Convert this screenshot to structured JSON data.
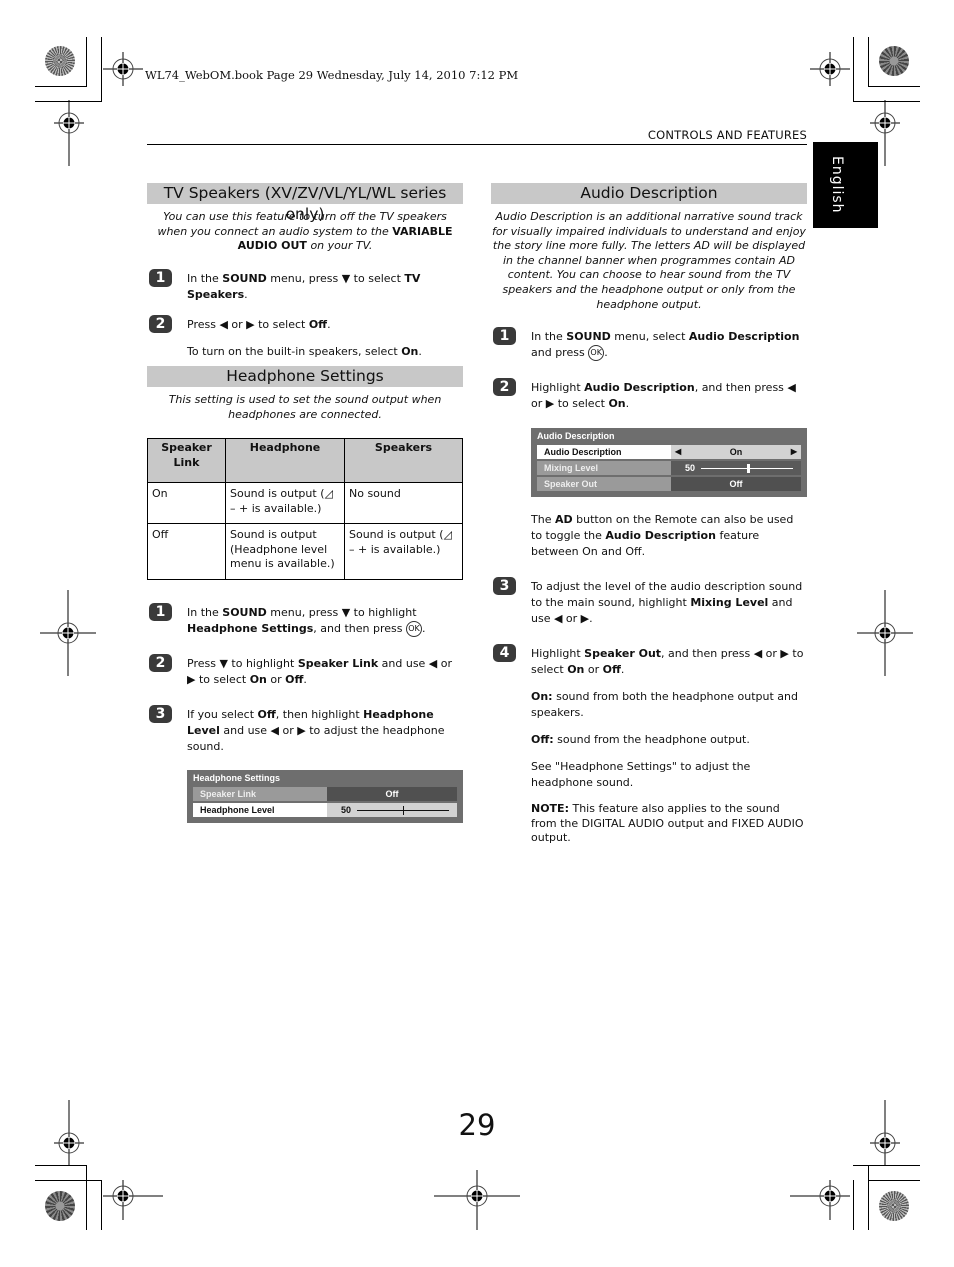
{
  "slug": "WL74_WebOM.book  Page 29  Wednesday, July 14, 2010  7:12 PM",
  "header": {
    "section": "CONTROLS AND FEATURES",
    "language_tab": "English"
  },
  "tv_speakers": {
    "title": "TV Speakers (XV/ZV/VL/YL/WL series only)",
    "intro_pre": "You can use this feature to turn off the TV speakers when you connect an audio system to the ",
    "intro_bold": "VARIABLE AUDIO OUT",
    "intro_post": " on your TV.",
    "steps": [
      {
        "num": "1",
        "t1": "In the ",
        "b1": "SOUND",
        "t2": " menu, press ▼ to select ",
        "b2": "TV Speakers",
        "t3": "."
      },
      {
        "num": "2",
        "t1": "Press ◀ or ▶ to select ",
        "b1": "Off",
        "t2": "."
      }
    ],
    "note_pre": "To turn on the built-in speakers, select ",
    "note_bold": "On",
    "note_post": "."
  },
  "headphone": {
    "title": "Headphone Settings",
    "intro": "This setting is used to set the sound output when headphones are connected.",
    "table": {
      "headers": [
        "Speaker Link",
        "Headphone",
        "Speakers"
      ],
      "rows": [
        [
          "On",
          " Sound is output (◿ – + is available.)",
          "No sound"
        ],
        [
          "Off",
          "Sound is output (Headphone level menu is available.)",
          "Sound is output (◿ – + is available.)"
        ]
      ]
    },
    "steps": [
      {
        "num": "1",
        "t1": "In the ",
        "b1": "SOUND",
        "t2": " menu, press ▼ to highlight ",
        "b2": "Headphone Settings",
        "t3": ", and then press ",
        "ok": "OK",
        "t4": "."
      },
      {
        "num": "2",
        "t1": "Press ▼ to highlight ",
        "b1": "Speaker Link",
        "t2": " and use ◀ or ▶ to select ",
        "b2": "On",
        "t3": " or ",
        "b3": "Off",
        "t4": "."
      },
      {
        "num": "3",
        "t1": "If you select ",
        "b1": "Off",
        "t2": ", then highlight ",
        "b2": "Headphone Level",
        "t3": " and use ◀ or ▶ to adjust the headphone sound."
      }
    ],
    "osd": {
      "title": "Headphone Settings",
      "rows": [
        {
          "label": "Speaker Link",
          "value": "Off"
        },
        {
          "label": "Headphone Level",
          "value": "50",
          "level_fraction": 0.5
        }
      ]
    }
  },
  "audio_description": {
    "title": "Audio Description",
    "intro": "Audio Description is an additional narrative sound track for visually impaired individuals to understand and enjoy the story line more fully. The letters AD will be displayed in the channel banner when programmes contain AD content.  You can choose to hear sound from the TV speakers and the headphone output or only from the headphone output.",
    "steps": [
      {
        "num": "1",
        "t1": "In the ",
        "b1": "SOUND",
        "t2": " menu, select ",
        "b2": "Audio Description",
        "t3": " and press ",
        "ok": "OK",
        "t4": "."
      },
      {
        "num": "2",
        "t1": "Highlight ",
        "b1": "Audio Description",
        "t2": ", and then press ◀ or ▶ to select ",
        "b2": "On",
        "t3": "."
      },
      {
        "num": "3",
        "t1": "To adjust the level of the audio description sound to the main sound, highlight ",
        "b1": "Mixing Level",
        "t2": " and use ◀ or ▶."
      },
      {
        "num": "4",
        "t1": "Highlight ",
        "b1": "Speaker Out",
        "t2": ", and then press ◀ or ▶ to select ",
        "b2": "On",
        "t3": " or ",
        "b3": "Off",
        "t4": "."
      }
    ],
    "osd": {
      "title": "Audio Description",
      "rows": [
        {
          "label": "Audio Description",
          "value": "On",
          "left_arrow": "◀",
          "right_arrow": "▶"
        },
        {
          "label": "Mixing Level",
          "value": "50",
          "level_fraction": 0.5
        },
        {
          "label": "Speaker Out",
          "value": "Off"
        }
      ]
    },
    "ad_note": {
      "t1": "The ",
      "b1": "AD",
      "t2": " button on the Remote can also be used to toggle the ",
      "b2": "Audio Description",
      "t3": " feature between On and Off."
    },
    "on_note": {
      "b": "On:",
      "t": " sound from both the headphone output and speakers."
    },
    "off_note": {
      "b": "Off:",
      "t": " sound from the headphone output."
    },
    "see_note": "See \"Headphone Settings\" to adjust the headphone sound.",
    "final_note": {
      "b": "NOTE:",
      "t": " This feature also applies to the sound from the DIGITAL AUDIO output and FIXED AUDIO output."
    }
  },
  "page_number": "29"
}
